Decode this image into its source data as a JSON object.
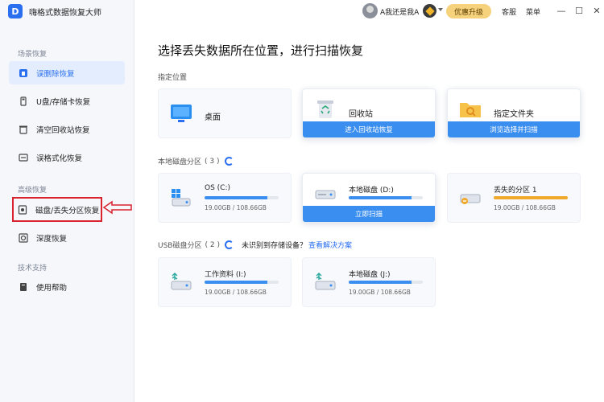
{
  "app": {
    "logo_letter": "D",
    "title": "嗨格式数据恢复大师"
  },
  "sidebar": {
    "groups": [
      {
        "label": "场景恢复"
      },
      {
        "label": "高级恢复"
      },
      {
        "label": "技术支持"
      }
    ],
    "items": [
      {
        "label": "误删除恢复",
        "icon": "trash-recover-icon",
        "active": true
      },
      {
        "label": "U盘/存储卡恢复",
        "icon": "usb-drive-icon"
      },
      {
        "label": "清空回收站恢复",
        "icon": "recycle-bin-icon"
      },
      {
        "label": "误格式化恢复",
        "icon": "format-disk-icon"
      },
      {
        "label": "磁盘/丢失分区恢复",
        "icon": "disk-partition-icon",
        "highlighted": true
      },
      {
        "label": "深度恢复",
        "icon": "deep-scan-icon"
      },
      {
        "label": "使用帮助",
        "icon": "help-book-icon"
      }
    ]
  },
  "topbar": {
    "user_name": "A我还是我A",
    "upgrade_label": "优惠升级",
    "service_label": "客服",
    "menu_label": "菜单",
    "minimize": "—",
    "maximize": "☐",
    "close": "✕"
  },
  "main": {
    "title": "选择丢失数据所在位置，进行扫描恢复",
    "locations": {
      "label": "指定位置",
      "items": [
        {
          "name": "桌面",
          "icon": "desktop-icon"
        },
        {
          "name": "回收站",
          "icon": "recycle-bin-icon",
          "action": "进入回收站恢复"
        },
        {
          "name": "指定文件夹",
          "icon": "folder-search-icon",
          "action": "浏览选择并扫描"
        }
      ]
    },
    "local_disks": {
      "label": "本地磁盘分区",
      "count": "( 3 )",
      "items": [
        {
          "name": "OS (C:)",
          "size": "19.00GB / 108.66GB",
          "usage": 0.85,
          "icon": "windows-disk-icon"
        },
        {
          "name": "本地磁盘 (D:)",
          "size": "19.00GB / 108.66GB",
          "usage": 0.85,
          "icon": "hard-disk-icon",
          "action": "立即扫描"
        },
        {
          "name": "丢失的分区 1",
          "size": "19.00GB / 108.66GB",
          "usage": 1.0,
          "icon": "lost-partition-icon"
        }
      ]
    },
    "usb_disks": {
      "label": "USB磁盘分区",
      "count": "( 2 )",
      "hint": "未识别到存储设备？",
      "link": "查看解决方案",
      "items": [
        {
          "name": "工作资料 (I:)",
          "size": "19.00GB / 108.66GB",
          "usage": 0.85,
          "icon": "usb-disk-icon"
        },
        {
          "name": "本地磁盘 (J:)",
          "size": "19.00GB / 108.66GB",
          "usage": 0.85,
          "icon": "usb-disk-icon"
        }
      ]
    }
  },
  "colors": {
    "accent": "#2a6ff0",
    "button_blue": "#3a8ef0",
    "highlight_red": "#d9232e",
    "lost_orange": "#f0a92a"
  }
}
